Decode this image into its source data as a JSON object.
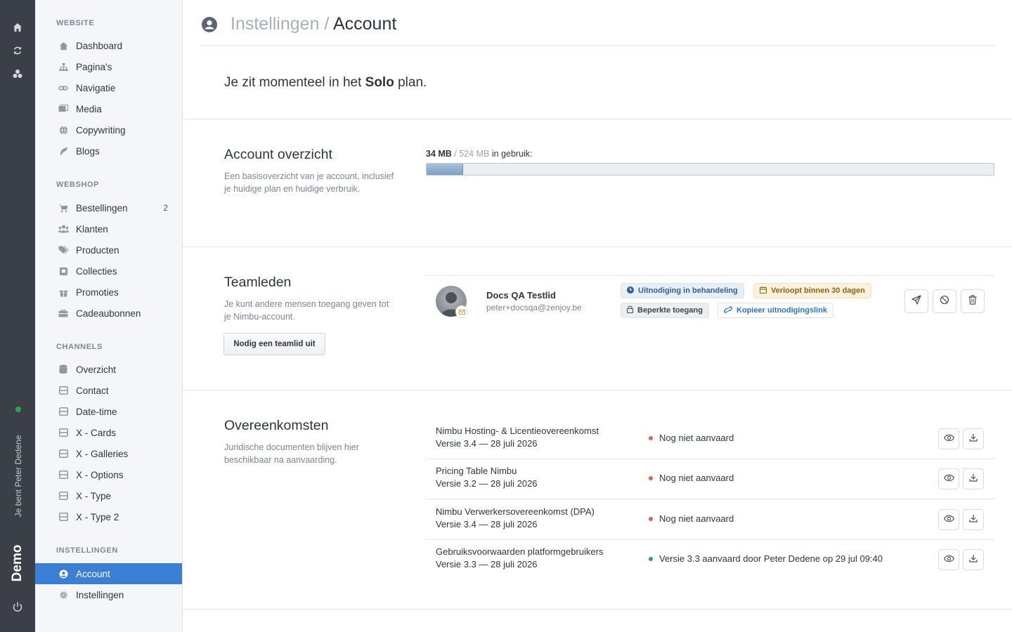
{
  "rail": {
    "icons": [
      "home-icon",
      "refresh-icon",
      "puzzle-icon"
    ],
    "user_label": "Je bent Peter Dedene",
    "brand": "Demo",
    "power_icon": "power-icon"
  },
  "sidebar": {
    "sections": [
      {
        "title": "WEBSITE",
        "items": [
          {
            "label": "Dashboard",
            "icon": "home-icon"
          },
          {
            "label": "Pagina's",
            "icon": "sitemap-icon"
          },
          {
            "label": "Navigatie",
            "icon": "link-icon"
          },
          {
            "label": "Media",
            "icon": "images-icon"
          },
          {
            "label": "Copywriting",
            "icon": "globe-icon"
          },
          {
            "label": "Blogs",
            "icon": "feather-icon"
          }
        ]
      },
      {
        "title": "WEBSHOP",
        "items": [
          {
            "label": "Bestellingen",
            "icon": "cart-icon",
            "badge": "2"
          },
          {
            "label": "Klanten",
            "icon": "users-icon"
          },
          {
            "label": "Producten",
            "icon": "tags-icon"
          },
          {
            "label": "Collecties",
            "icon": "collection-icon"
          },
          {
            "label": "Promoties",
            "icon": "gift-icon"
          },
          {
            "label": "Cadeaubonnen",
            "icon": "giftcard-icon"
          }
        ]
      },
      {
        "title": "CHANNELS",
        "items": [
          {
            "label": "Overzicht",
            "icon": "database-icon"
          },
          {
            "label": "Contact",
            "icon": "channel-icon"
          },
          {
            "label": "Date-time",
            "icon": "channel-icon"
          },
          {
            "label": "X - Cards",
            "icon": "channel-icon"
          },
          {
            "label": "X - Galleries",
            "icon": "channel-icon"
          },
          {
            "label": "X - Options",
            "icon": "channel-icon"
          },
          {
            "label": "X - Type",
            "icon": "channel-icon"
          },
          {
            "label": "X - Type 2",
            "icon": "channel-icon"
          }
        ]
      },
      {
        "title": "INSTELLINGEN",
        "items": [
          {
            "label": "Account",
            "icon": "user-circle-icon",
            "active": true
          },
          {
            "label": "Instellingen",
            "icon": "gear-icon"
          }
        ]
      }
    ]
  },
  "header": {
    "parent": "Instellingen",
    "separator": "/",
    "current": "Account"
  },
  "plan": {
    "prefix": "Je zit momenteel in het",
    "name": "Solo",
    "suffix": "plan."
  },
  "overview": {
    "title": "Account overzicht",
    "description": "Een basisoverzicht van je account, inclusief je huidige plan en huidige verbruik.",
    "used": "34 MB",
    "separator": "/",
    "total": "524 MB",
    "suffix": "in gebruik:",
    "usage_fraction": 0.065
  },
  "team": {
    "title": "Teamleden",
    "description": "Je kunt andere mensen toegang geven tot je Nimbu-account.",
    "invite_button": "Nodig een teamlid uit",
    "members": [
      {
        "name": "Docs QA Testlid",
        "email": "peter+docsqa@zenjoy.be",
        "status_pill": "Uitnodiging in behandeling",
        "expiry_pill": "Verloopt binnen 30 dagen",
        "access_pill": "Beperkte toegang",
        "link_pill": "Kopieer uitnodigingslink"
      }
    ]
  },
  "agreements": {
    "title": "Overeenkomsten",
    "description": "Juridische documenten blijven hier beschikbaar na aanvaarding.",
    "documents": [
      {
        "title": "Nimbu Hosting- & Licentieovereenkomst",
        "version": "Versie 3.4 — 28 juli 2026",
        "status": "Nog niet aanvaard",
        "accepted": false
      },
      {
        "title": "Pricing Table Nimbu",
        "version": "Versie 3.2 — 28 juli 2026",
        "status": "Nog niet aanvaard",
        "accepted": false
      },
      {
        "title": "Nimbu Verwerkersovereenkomst (DPA)",
        "version": "Versie 3.4 — 28 juli 2026",
        "status": "Nog niet aanvaard",
        "accepted": false
      },
      {
        "title": "Gebruiksvoorwaarden platformgebruikers",
        "version": "Versie 3.3 — 28 juli 2026",
        "status": "Versie 3.3 aanvaard door Peter Dedene op 29 jul 09:40",
        "accepted": true
      }
    ]
  },
  "colors": {
    "accent": "#3a7fd4",
    "rail": "#3b4048",
    "status_pending": "#e0614f",
    "status_ok": "#2fa24f"
  }
}
